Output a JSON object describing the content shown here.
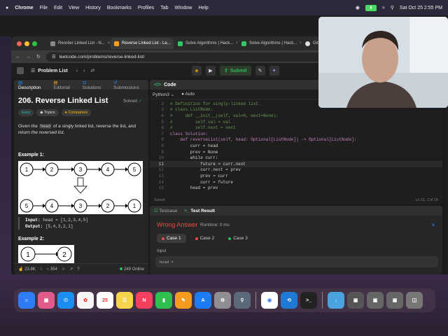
{
  "menubar": {
    "apple": "",
    "items": [
      "Chrome",
      "File",
      "Edit",
      "View",
      "History",
      "Bookmarks",
      "Profiles",
      "Tab",
      "Window",
      "Help"
    ],
    "clock": "Sat Oct 25  2:55 PM"
  },
  "browser": {
    "tabs": [
      {
        "title": "Reorder Linked List - N...",
        "active": false
      },
      {
        "title": "Reverse Linked List - Le...",
        "active": true
      },
      {
        "title": "Solve Algorithms | Hack...",
        "active": false
      },
      {
        "title": "Solve Algorithms | Hack...",
        "active": false
      },
      {
        "title": "GitHub",
        "active": false
      }
    ],
    "url": "leetcode.com/problems/reverse-linked-list/"
  },
  "leetcode": {
    "problem_list": "Problem List",
    "submit": "Submit",
    "left_tabs": [
      "Description",
      "Editorial",
      "Solutions",
      "Submissions"
    ],
    "title": "206. Reverse Linked List",
    "solved": "Solved",
    "difficulty": "Easy",
    "topics": "Topics",
    "companies": "Companies",
    "desc_pre": "Given the",
    "desc_code": "head",
    "desc_mid": "of a singly linked list, reverse the list, and return",
    "desc_em": "the reversed list",
    "example1": "Example 1:",
    "ex1_top": [
      "1",
      "2",
      "3",
      "4",
      "5"
    ],
    "ex1_bottom": [
      "5",
      "4",
      "3",
      "2",
      "1"
    ],
    "input_label": "Input:",
    "input_val": "head = [1,2,3,4,5]",
    "output_label": "Output:",
    "output_val": "[5,4,3,2,1]",
    "example2": "Example 2:",
    "ex2_nodes": [
      "1",
      "2"
    ],
    "likes": "23.8K",
    "comments": "354",
    "online": "249 Online"
  },
  "editor": {
    "title": "Code",
    "language": "Python3",
    "mode": "Auto",
    "lines": [
      {
        "n": "2",
        "t": "# Definition for singly-linked list."
      },
      {
        "n": "3",
        "t": "# class ListNode:"
      },
      {
        "n": "4",
        "t": "#     def __init__(self, val=0, next=None):"
      },
      {
        "n": "5",
        "t": "#         self.val = val"
      },
      {
        "n": "6",
        "t": "#         self.next = next"
      },
      {
        "n": "7",
        "t": "class Solution:"
      },
      {
        "n": "8",
        "t": "    def reverseList(self, head: Optional[ListNode]) -> Optional[ListNode]:"
      },
      {
        "n": "9",
        "t": "        curr = head"
      },
      {
        "n": "9",
        "t": "        prev = None"
      },
      {
        "n": "10",
        "t": "        while curr:"
      },
      {
        "n": "11",
        "t": "            future = curr.next"
      },
      {
        "n": "12",
        "t": "            curr.next = prev"
      },
      {
        "n": "13",
        "t": "            prev = curr"
      },
      {
        "n": "14",
        "t": "            curr = future"
      },
      {
        "n": "15",
        "t": "        head = prev"
      }
    ],
    "status": "Saved",
    "cursor": "Ln 11, Col 15"
  },
  "result": {
    "tabs": [
      "Testcase",
      "Test Result"
    ],
    "verdict": "Wrong Answer",
    "runtime": "Runtime: 0 ms",
    "cases": [
      "Case 1",
      "Case 2",
      "Case 3"
    ],
    "input_label": "Input",
    "input_val": "head ="
  },
  "colors": {
    "accent_green": "#2cbb5d",
    "wrong_red": "#ef4743",
    "easy_teal": "#1cbaba"
  }
}
